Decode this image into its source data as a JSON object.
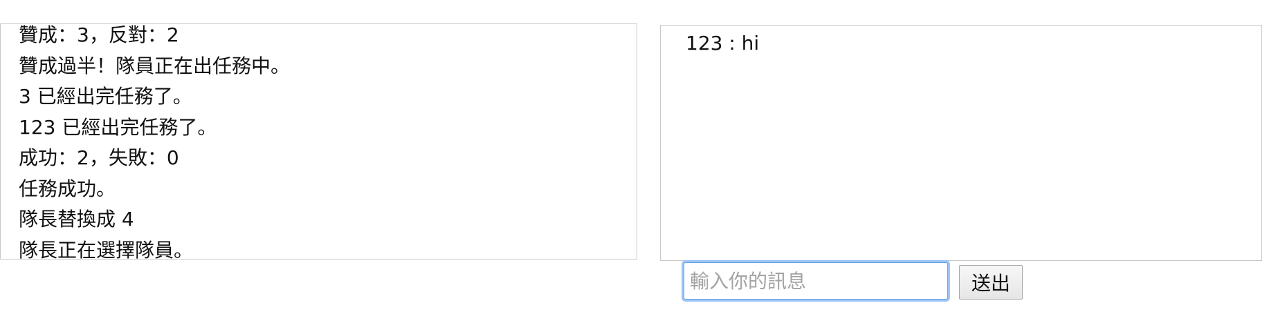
{
  "game_log": {
    "lines": [
      "贊成：3，反對：2",
      "贊成過半！隊員正在出任務中。",
      "3 已經出完任務了。",
      "123 已經出完任務了。",
      "成功：2，失敗：0",
      "任務成功。",
      "隊長替換成 4",
      "隊長正在選擇隊員。"
    ]
  },
  "chat": {
    "messages": [
      "123 : hi"
    ],
    "input_placeholder": "輸入你的訊息",
    "input_value": "",
    "send_label": "送出"
  }
}
